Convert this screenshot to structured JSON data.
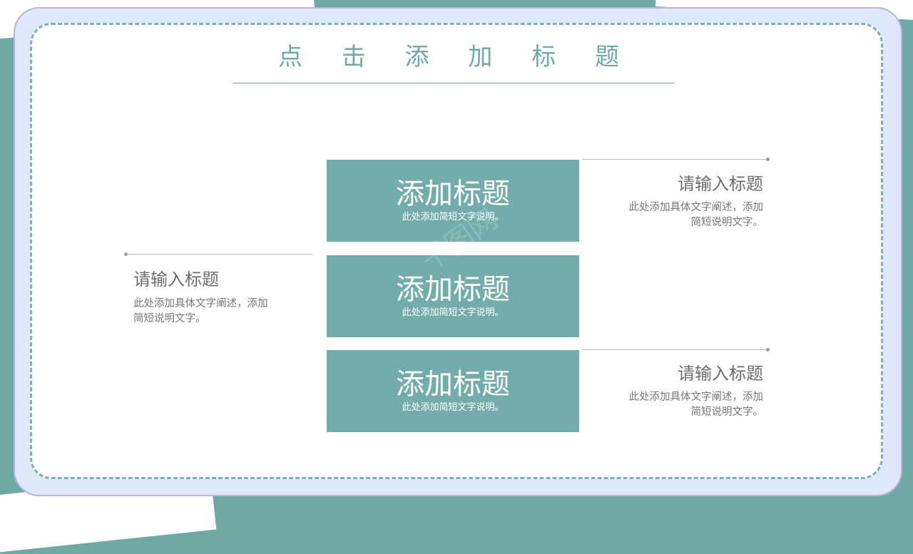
{
  "title": "点 击 添 加 标 题",
  "blocks": [
    {
      "title": "添加标题",
      "subtitle": "此处添加简短文字说明。"
    },
    {
      "title": "添加标题",
      "subtitle": "此处添加简短文字说明。"
    },
    {
      "title": "添加标题",
      "subtitle": "此处添加简短文字说明。"
    }
  ],
  "side_items": [
    {
      "title": "请输入标题",
      "desc_line1": "此处添加具体文字阐述，添加",
      "desc_line2": "简短说明文字。"
    },
    {
      "title": "请输入标题",
      "desc_line1": "此处添加具体文字阐述，添加",
      "desc_line2": "简短说明文字。"
    },
    {
      "title": "请输入标题",
      "desc_line1": "此处添加具体文字阐述，添加",
      "desc_line2": "简短说明文字。"
    }
  ],
  "watermark": "千图网",
  "colors": {
    "accent": "#72adab",
    "frame": "#dfe8fb",
    "text_gray": "#6d6d6d"
  }
}
